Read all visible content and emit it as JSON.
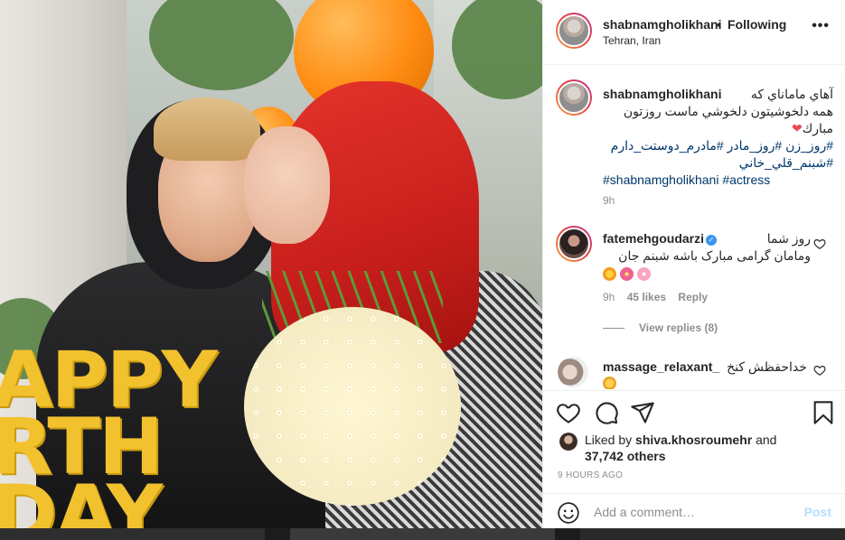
{
  "header": {
    "username": "shabnamgholikhani",
    "dot": "•",
    "follow_status": "Following",
    "location": "Tehran, Iran",
    "more_icon": "more-horizontal-icon"
  },
  "caption": {
    "username": "shabnamgholikhani",
    "line1": "آهاي ماماناي که",
    "line2": "همه دلخوشيتون دلخوشي ماست روزتون",
    "line3": "مبارك",
    "heart": "❤",
    "tags_line1": "#روز_زن #روز_مادر #مادرم_دوستت_دارم",
    "tags_line2": "#شبنم_قلي_خاني",
    "tags_line3": "#shabnamgholikhani #actress",
    "time": "9h"
  },
  "comments": [
    {
      "username": "fatemehgoudarzi",
      "verified": true,
      "text_line1": "روز شما",
      "text_line2": "ومامان گرامی مبارک باشه شبنم جان",
      "emojis": [
        "sun-emoji",
        "hibiscus-emoji",
        "cherry-blossom-emoji"
      ],
      "time": "9h",
      "likes": "45 likes",
      "reply_label": "Reply",
      "view_replies": "View replies (8)"
    },
    {
      "username": "massage_relaxant_",
      "text": "خداحفظش کنخ",
      "emoji": "folded-hands-emoji"
    }
  ],
  "actions": {
    "icons": [
      "heart-icon",
      "comment-icon",
      "share-icon",
      "bookmark-icon"
    ],
    "liked_by_prefix": "Liked by ",
    "liked_by_user": "shiva.khosroumehr",
    "liked_by_and": " and",
    "liked_others": "37,742 others",
    "age": "9 HOURS AGO"
  },
  "add_comment": {
    "placeholder": "Add a comment…",
    "post_label": "Post",
    "emoji_icon": "smiley-icon"
  },
  "photo": {
    "banner_text": "APPY\nRTH\nDAY"
  },
  "colors": {
    "link": "#00376b",
    "verified": "#3897f0",
    "muted": "#8e8e8e",
    "post_disabled": "#b2dffc",
    "heart": "#ed4956"
  }
}
